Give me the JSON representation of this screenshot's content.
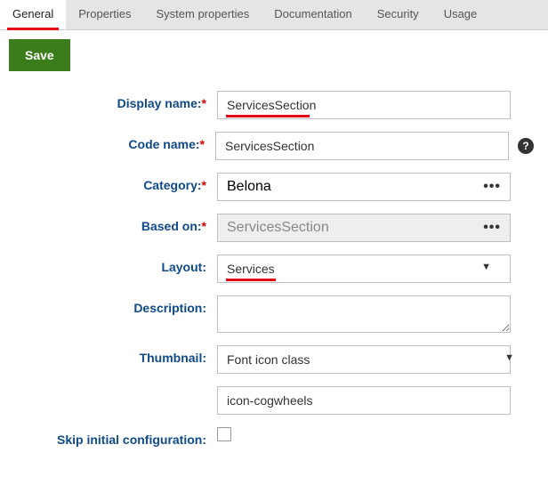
{
  "tabs": {
    "general": "General",
    "properties": "Properties",
    "system": "System properties",
    "documentation": "Documentation",
    "security": "Security",
    "usage": "Usage"
  },
  "save_label": "Save",
  "labels": {
    "display_name": "Display name:",
    "code_name": "Code name:",
    "category": "Category:",
    "based_on": "Based on:",
    "layout": "Layout:",
    "description": "Description:",
    "thumbnail": "Thumbnail:",
    "skip_initial": "Skip initial configuration:"
  },
  "values": {
    "display_name": "ServicesSection",
    "code_name": "ServicesSection",
    "category": "Belona",
    "based_on": "ServicesSection",
    "layout": "Services",
    "description": "",
    "thumbnail_type": "Font icon class",
    "thumbnail_icon": "icon-cogwheels",
    "skip_initial": false
  },
  "more_glyph": "•••",
  "help_glyph": "?"
}
